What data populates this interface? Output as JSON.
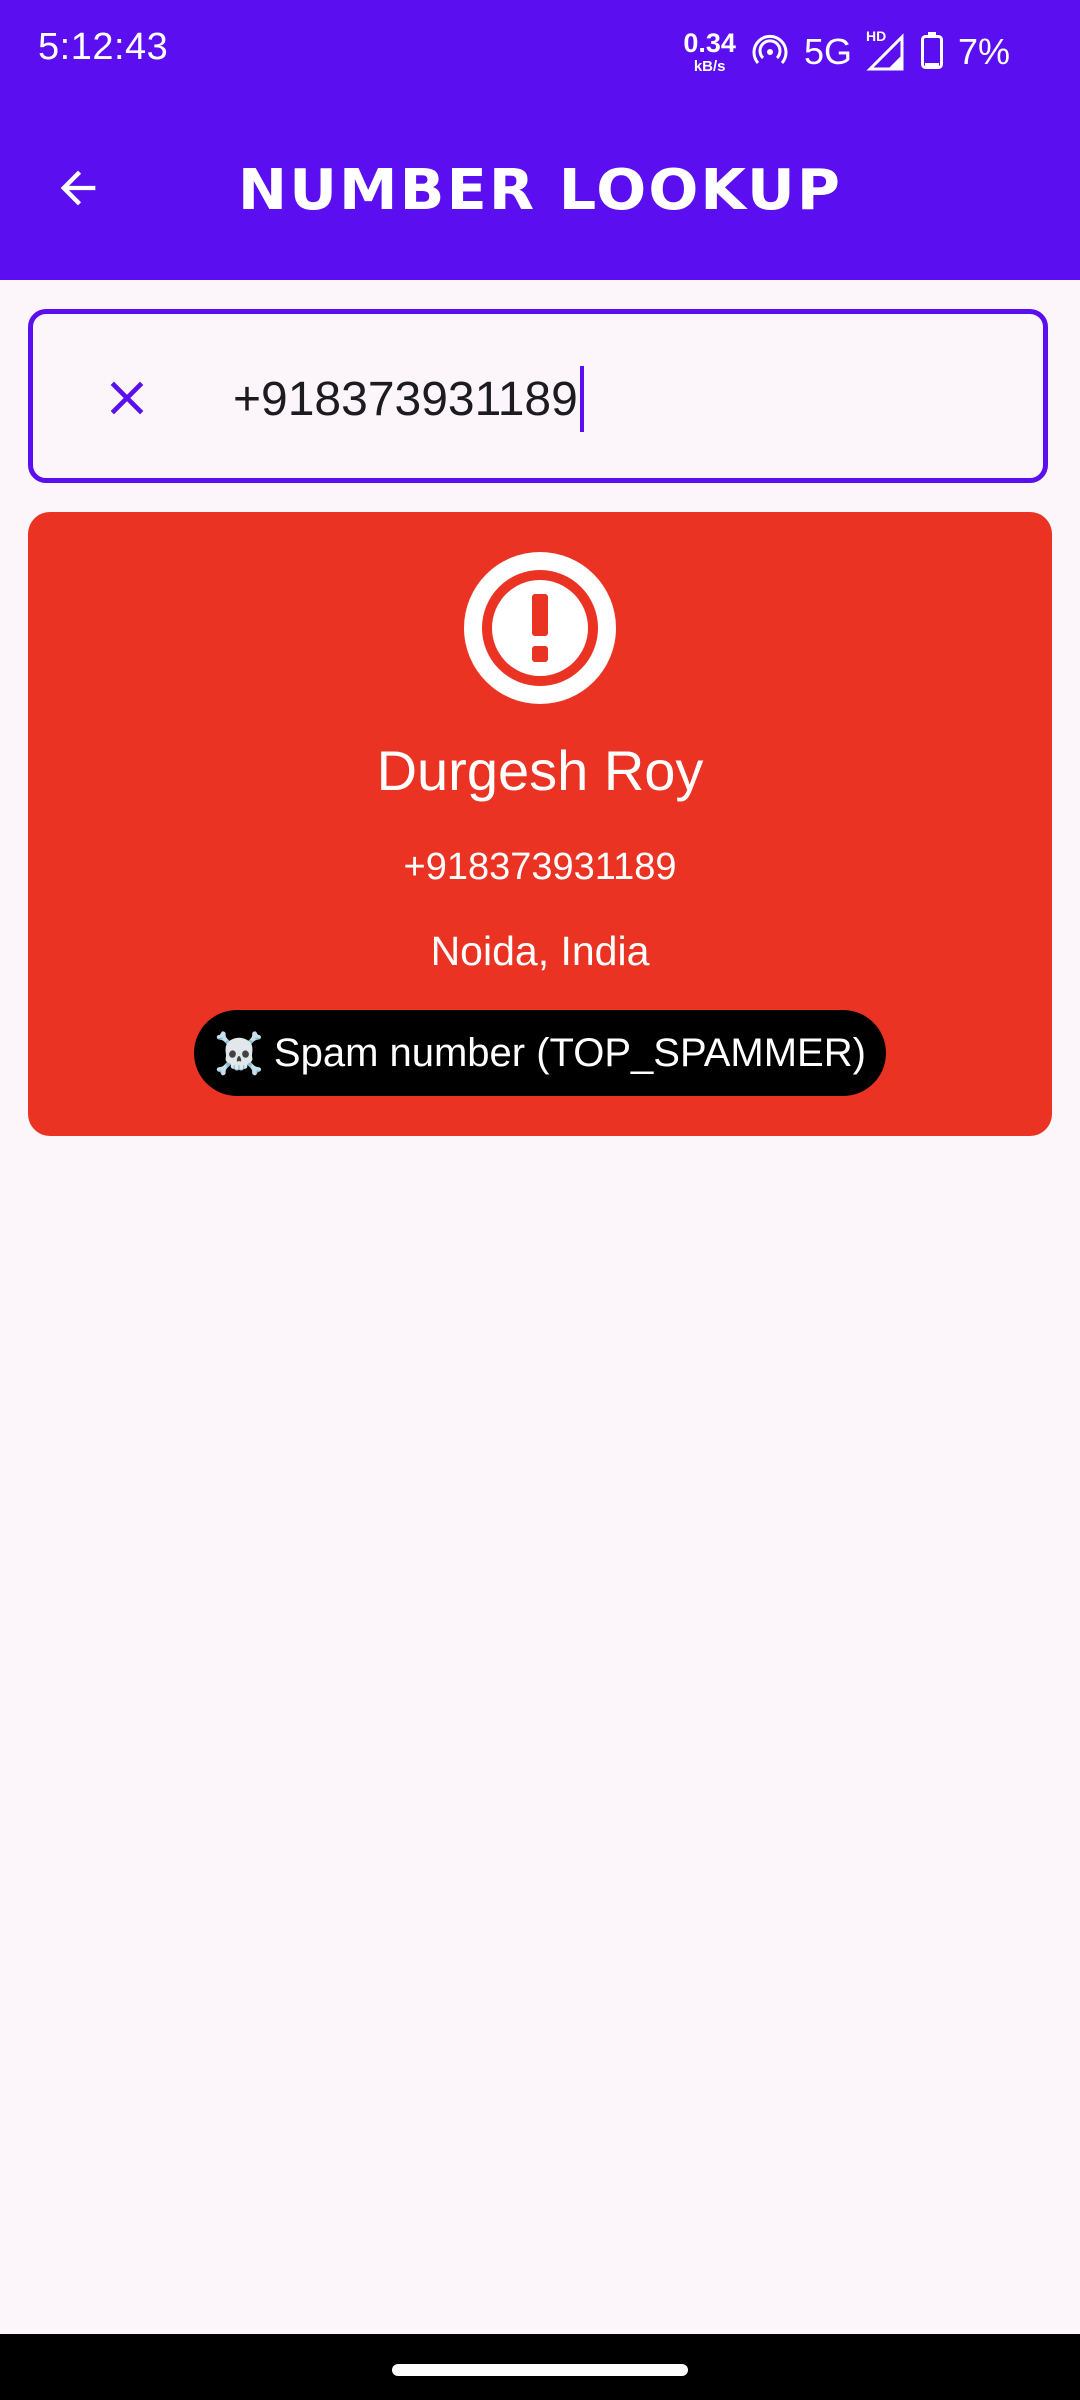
{
  "status_bar": {
    "time": "5:12:43",
    "net_speed_value": "0.34",
    "net_speed_unit": "kB/s",
    "network_type": "5G",
    "hd_label": "HD",
    "battery_percent": "7%",
    "icons": [
      "hotspot-icon",
      "signal-icon",
      "battery-icon"
    ]
  },
  "header": {
    "title": "NUMBER LOOKUP",
    "back_icon": "arrow-back-icon",
    "background_color": "#5B0EF0"
  },
  "search": {
    "value": "+918373931189",
    "clear_icon": "close-icon",
    "border_color": "#5B0EF0"
  },
  "result": {
    "status_icon": "alert-circle-icon",
    "name": "Durgesh Roy",
    "number": "+918373931189",
    "location": "Noida, India",
    "badge_emoji": "☠️",
    "badge_text": "Spam number (TOP_SPAMMER)",
    "card_color": "#EA3323"
  }
}
